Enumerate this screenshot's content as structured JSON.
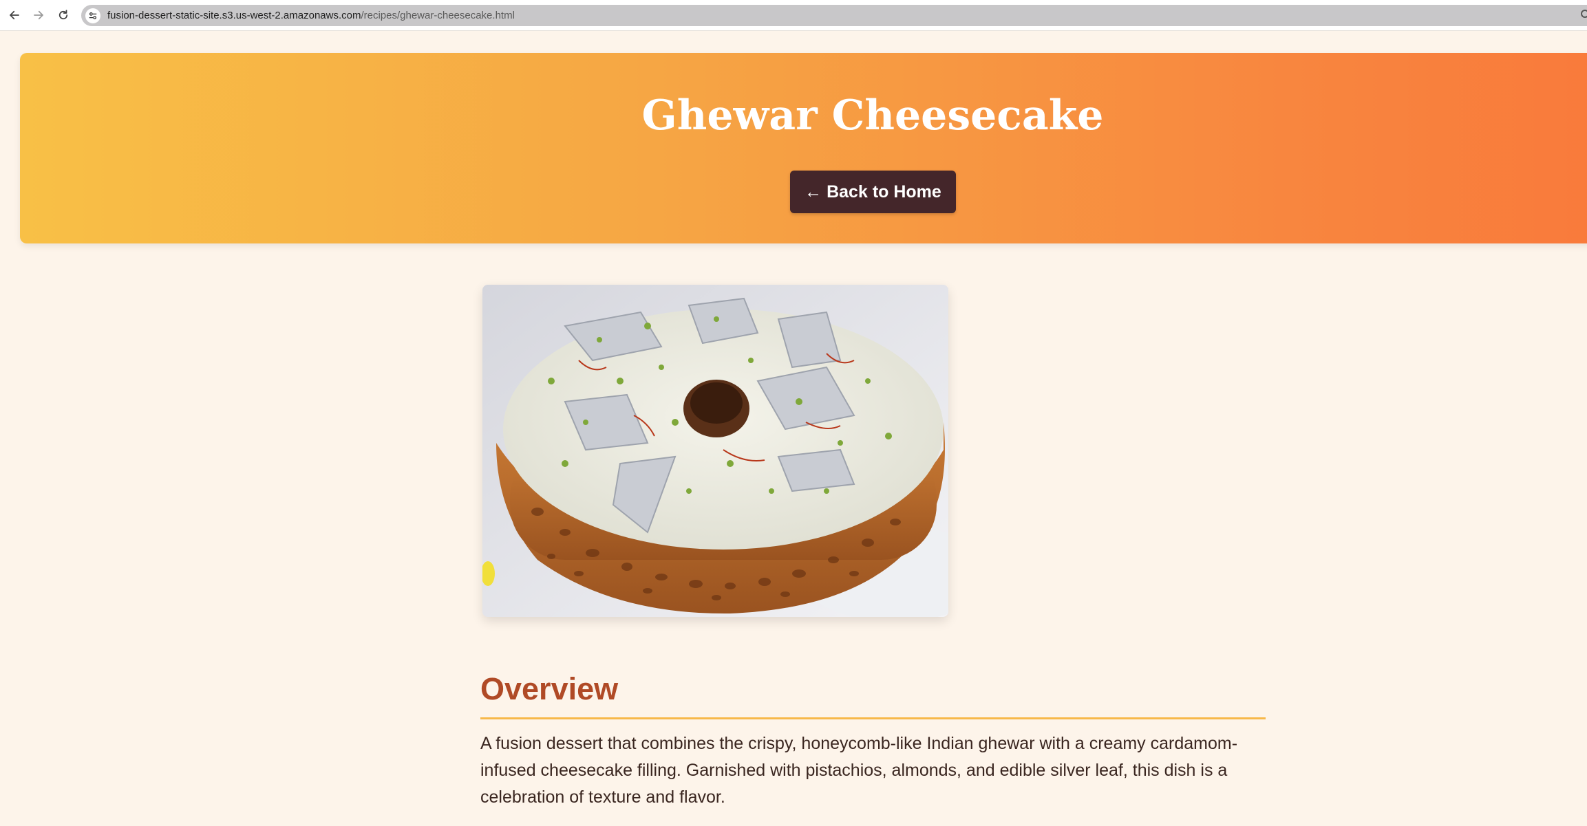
{
  "browser": {
    "url_domain": "fusion-dessert-static-site.s3.us-west-2.amazonaws.com",
    "url_path": "/recipes/ghewar-cheesecake.html",
    "icons": [
      "back-arrow-icon",
      "forward-arrow-icon",
      "reload-icon",
      "site-settings-icon"
    ]
  },
  "hero": {
    "title": "Ghewar Cheesecake",
    "back_label": "← Back to Home",
    "gradient_colors": [
      "#f8c046",
      "#f97a3b"
    ],
    "button_color": "#44262a"
  },
  "image": {
    "alt": "Ghewar Cheesecake"
  },
  "overview": {
    "heading": "Overview",
    "text": "A fusion dessert that combines the crispy, honeycomb-like Indian ghewar with a creamy cardamom-infused cheesecake filling. Garnished with pistachios, almonds, and edible silver leaf, this dish is a celebration of texture and flavor.",
    "heading_color": "#b04a26",
    "accent_color": "#f7b84a"
  }
}
